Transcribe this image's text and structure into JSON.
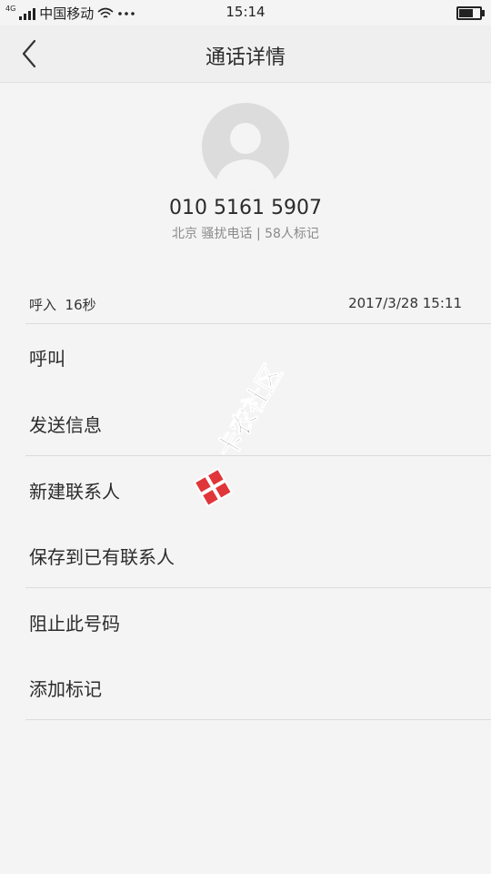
{
  "status_bar": {
    "network_type": "4G",
    "carrier": "中国移动",
    "time": "15:14",
    "battery_level": 0.75,
    "icons": [
      "signal-icon",
      "wifi-icon",
      "more-dots-icon",
      "battery-icon"
    ]
  },
  "header": {
    "title": "通话详情",
    "back_icon": "chevron-left-icon"
  },
  "contact": {
    "number": "010 5161 5907",
    "info": "北京 骚扰电话 | 58人标记"
  },
  "call_log": {
    "direction_duration": "呼入  16秒",
    "datetime": "2017/3/28 15:11"
  },
  "actions": [
    {
      "label": "呼叫"
    },
    {
      "label": "发送信息"
    },
    {
      "label": "新建联系人"
    },
    {
      "label": "保存到已有联系人"
    },
    {
      "label": "阻止此号码"
    },
    {
      "label": "添加标记"
    }
  ],
  "watermark": {
    "text": "卡农社区",
    "color": "#e0363a"
  }
}
